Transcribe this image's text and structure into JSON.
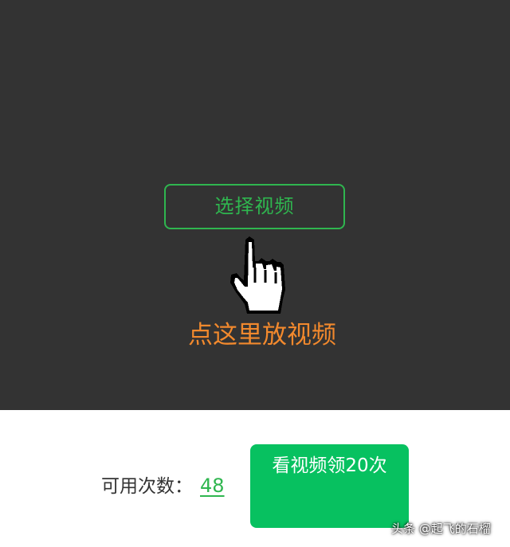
{
  "preview": {
    "select_video_label": "选择视频",
    "hint_text": "点这里放视频",
    "hand_icon": "pointing-hand-icon"
  },
  "footer": {
    "usage_label": "可用次数：",
    "usage_count": "48",
    "watch_video_label": "看视频领20次"
  },
  "watermark": {
    "text": "头条 @起飞的石榴"
  },
  "colors": {
    "preview_background": "#333333",
    "accent_green": "#2fb64f",
    "button_green": "#07c160",
    "hint_orange": "#f2892d"
  }
}
